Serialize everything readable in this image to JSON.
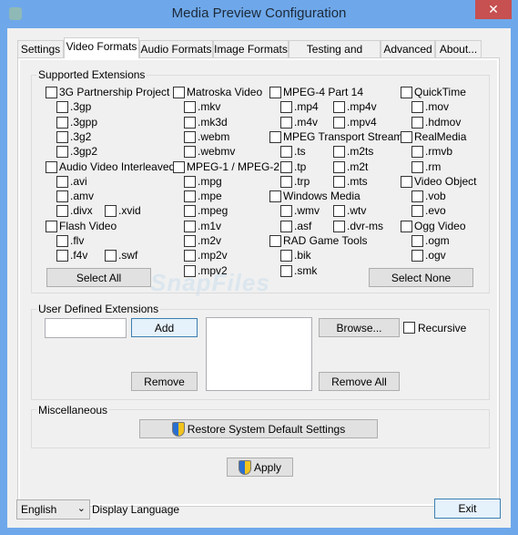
{
  "window": {
    "title": "Media Preview Configuration",
    "close_icon": "close-icon"
  },
  "tabs": [
    {
      "label": "Settings"
    },
    {
      "label": "Video Formats",
      "active": true
    },
    {
      "label": "Audio Formats"
    },
    {
      "label": "Image Formats"
    },
    {
      "label": "Testing and Cache"
    },
    {
      "label": "Advanced"
    },
    {
      "label": "About..."
    }
  ],
  "supported": {
    "title": "Supported Extensions",
    "columns": [
      [
        [
          "3G Partnership Project"
        ],
        [
          ".3gp"
        ],
        [
          ".3gpp"
        ],
        [
          ".3g2"
        ],
        [
          ".3gp2"
        ],
        [
          "Audio Video Interleaved"
        ],
        [
          ".avi"
        ],
        [
          ".amv"
        ],
        [
          ".divx",
          ".xvid"
        ],
        [
          "Flash Video"
        ],
        [
          ".flv"
        ],
        [
          ".f4v",
          ".swf"
        ]
      ],
      [
        [
          "Matroska Video"
        ],
        [
          ".mkv"
        ],
        [
          ".mk3d"
        ],
        [
          ".webm"
        ],
        [
          ".webmv"
        ],
        [
          "MPEG-1 / MPEG-2"
        ],
        [
          ".mpg"
        ],
        [
          ".mpe"
        ],
        [
          ".mpeg"
        ],
        [
          ".m1v"
        ],
        [
          ".m2v"
        ],
        [
          ".mp2v"
        ],
        [
          ".mpv2"
        ]
      ],
      [
        [
          "MPEG-4 Part 14"
        ],
        [
          ".mp4",
          ".mp4v"
        ],
        [
          ".m4v",
          ".mpv4"
        ],
        [
          "MPEG Transport Stream"
        ],
        [
          ".ts",
          ".m2ts"
        ],
        [
          ".tp",
          ".m2t"
        ],
        [
          ".trp",
          ".mts"
        ],
        [
          "Windows Media"
        ],
        [
          ".wmv",
          ".wtv"
        ],
        [
          ".asf",
          ".dvr-ms"
        ],
        [
          "RAD Game Tools"
        ],
        [
          ".bik"
        ],
        [
          ".smk"
        ]
      ],
      [
        [
          "QuickTime"
        ],
        [
          ".mov"
        ],
        [
          ".hdmov"
        ],
        [
          "RealMedia"
        ],
        [
          ".rmvb"
        ],
        [
          ".rm"
        ],
        [
          "Video Object"
        ],
        [
          ".vob"
        ],
        [
          ".evo"
        ],
        [
          "Ogg Video"
        ],
        [
          ".ogm"
        ],
        [
          ".ogv"
        ]
      ]
    ],
    "select_all": "Select All",
    "select_none": "Select None"
  },
  "user_defined": {
    "title": "User Defined Extensions",
    "input_value": "",
    "add": "Add",
    "remove": "Remove",
    "browse": "Browse...",
    "recursive": "Recursive",
    "recursive_checked": false,
    "remove_all": "Remove All"
  },
  "misc": {
    "title": "Miscellaneous",
    "restore": "Restore System Default Settings"
  },
  "apply": "Apply",
  "language": {
    "value": "English",
    "label": "Display Language"
  },
  "exit": "Exit",
  "watermark": "SnapFiles"
}
